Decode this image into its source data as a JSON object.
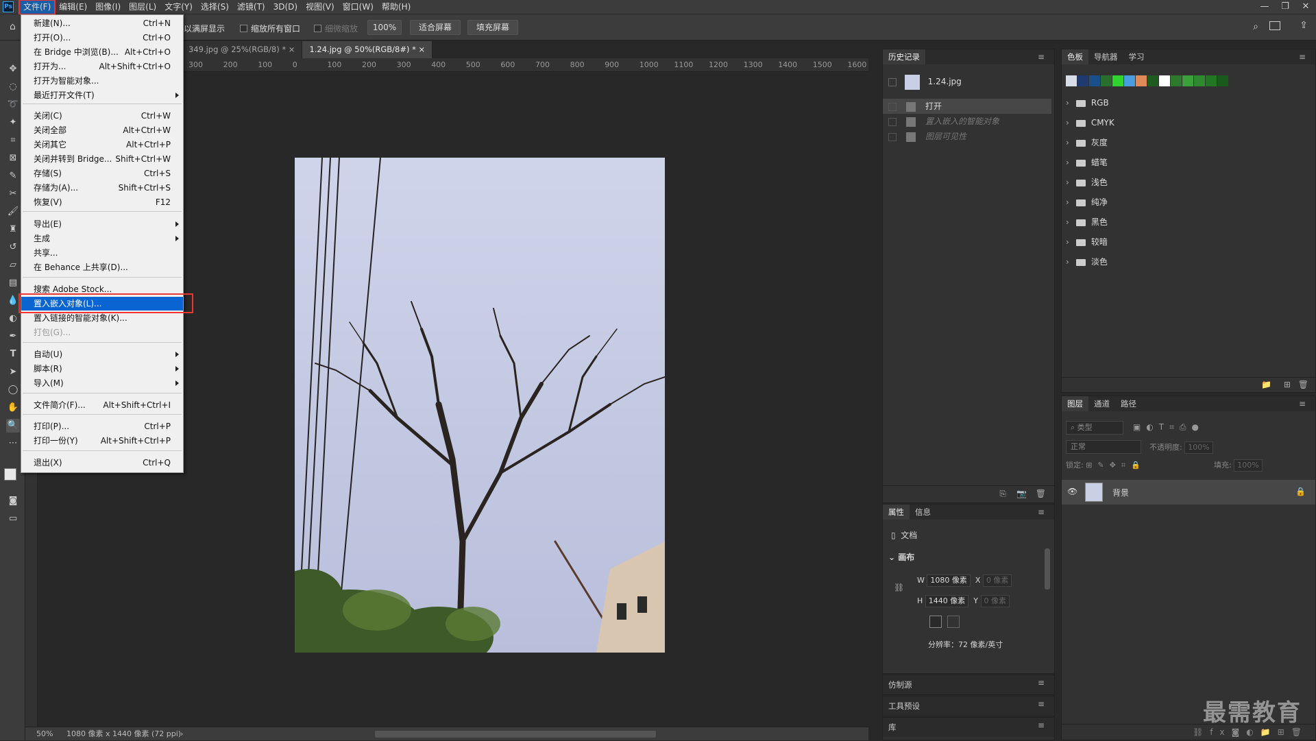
{
  "app": {
    "logo": "Ps"
  },
  "menubar": {
    "items": [
      "文件(F)",
      "编辑(E)",
      "图像(I)",
      "图层(L)",
      "文字(Y)",
      "选择(S)",
      "滤镜(T)",
      "3D(D)",
      "视图(V)",
      "窗口(W)",
      "帮助(H)"
    ],
    "window_controls": [
      "—",
      "❐",
      "✕"
    ]
  },
  "options": {
    "fullscreen_label": "以满屏显示",
    "zoom_all_windows": "缩放所有窗口",
    "scrubby_zoom": "细微缩放",
    "zoom_value": "100%",
    "fit_screen": "适合屏幕",
    "fill_screen": "填充屏幕"
  },
  "tabs": [
    {
      "label": "349.jpg @ 25%(RGB/8) *",
      "close": "×"
    },
    {
      "label": "1.24.jpg @ 50%(RGB/8#) *",
      "close": "×"
    }
  ],
  "ruler_top": [
    "300",
    "200",
    "100",
    "0",
    "100",
    "200",
    "300",
    "400",
    "500",
    "600",
    "700",
    "800",
    "900",
    "1000",
    "1100",
    "1200",
    "1300",
    "1400",
    "1500",
    "1600"
  ],
  "file_menu": [
    {
      "label": "新建(N)...",
      "shortcut": "Ctrl+N"
    },
    {
      "label": "打开(O)...",
      "shortcut": "Ctrl+O"
    },
    {
      "label": "在 Bridge 中浏览(B)...",
      "shortcut": "Alt+Ctrl+O"
    },
    {
      "label": "打开为...",
      "shortcut": "Alt+Shift+Ctrl+O"
    },
    {
      "label": "打开为智能对象...",
      "shortcut": ""
    },
    {
      "label": "最近打开文件(T)",
      "shortcut": ""
    },
    {
      "label": "关闭(C)",
      "shortcut": "Ctrl+W"
    },
    {
      "label": "关闭全部",
      "shortcut": "Alt+Ctrl+W"
    },
    {
      "label": "关闭其它",
      "shortcut": "Alt+Ctrl+P"
    },
    {
      "label": "关闭并转到 Bridge...",
      "shortcut": "Shift+Ctrl+W"
    },
    {
      "label": "存储(S)",
      "shortcut": "Ctrl+S"
    },
    {
      "label": "存储为(A)...",
      "shortcut": "Shift+Ctrl+S"
    },
    {
      "label": "恢复(V)",
      "shortcut": "F12"
    },
    {
      "label": "导出(E)",
      "shortcut": ""
    },
    {
      "label": "生成",
      "shortcut": ""
    },
    {
      "label": "共享...",
      "shortcut": ""
    },
    {
      "label": "在 Behance 上共享(D)...",
      "shortcut": ""
    },
    {
      "label": "搜索 Adobe Stock...",
      "shortcut": ""
    },
    {
      "label": "置入嵌入对象(L)...",
      "shortcut": ""
    },
    {
      "label": "置入链接的智能对象(K)...",
      "shortcut": ""
    },
    {
      "label": "打包(G)...",
      "shortcut": ""
    },
    {
      "label": "自动(U)",
      "shortcut": ""
    },
    {
      "label": "脚本(R)",
      "shortcut": ""
    },
    {
      "label": "导入(M)",
      "shortcut": ""
    },
    {
      "label": "文件简介(F)...",
      "shortcut": "Alt+Shift+Ctrl+I"
    },
    {
      "label": "打印(P)...",
      "shortcut": "Ctrl+P"
    },
    {
      "label": "打印一份(Y)",
      "shortcut": "Alt+Shift+Ctrl+P"
    },
    {
      "label": "退出(X)",
      "shortcut": "Ctrl+Q"
    }
  ],
  "history": {
    "tab": "历史记录",
    "snapshot": "1.24.jpg",
    "items": [
      "打开",
      "置入嵌入的智能对象",
      "图层可见性"
    ]
  },
  "swatches": {
    "tabs": [
      "色板",
      "导航器",
      "学习"
    ],
    "colors": [
      "#d8dde8",
      "#1e3a6e",
      "#1b4f8a",
      "#2a6e2e",
      "#2fd42f",
      "#4a9ee0",
      "#e08a5a",
      "#1f5a1f",
      "#ffffff",
      "#2d7a2d",
      "#3aa03a",
      "#2f8a2f",
      "#227722",
      "#1a5a1a"
    ],
    "folders": [
      "RGB",
      "CMYK",
      "灰度",
      "蜡笔",
      "浅色",
      "纯净",
      "黑色",
      "较暗",
      "淡色"
    ]
  },
  "properties": {
    "tabs": [
      "属性",
      "信息"
    ],
    "doc_label": "文档",
    "section": "画布",
    "w_label": "W",
    "w_value": "1080 像素",
    "h_label": "H",
    "h_value": "1440 像素",
    "x_label": "X",
    "x_value": "0 像素",
    "y_label": "Y",
    "y_value": "0 像素",
    "resolution": "分辨率：72 像素/英寸"
  },
  "collapsed_panels": [
    "仿制源",
    "工具预设",
    "库"
  ],
  "layers": {
    "tabs": [
      "图层",
      "通道",
      "路径"
    ],
    "filter_placeholder": "类型",
    "blend_mode": "正常",
    "opacity_label": "不透明度:",
    "opacity_value": "100%",
    "lock_label": "锁定:",
    "fill_label": "填充:",
    "fill_value": "100%",
    "layer_name": "背景"
  },
  "status": {
    "zoom": "50%",
    "doc_info": "1080 像素 x 1440 像素 (72 ppi)"
  },
  "watermark": "最需教育"
}
